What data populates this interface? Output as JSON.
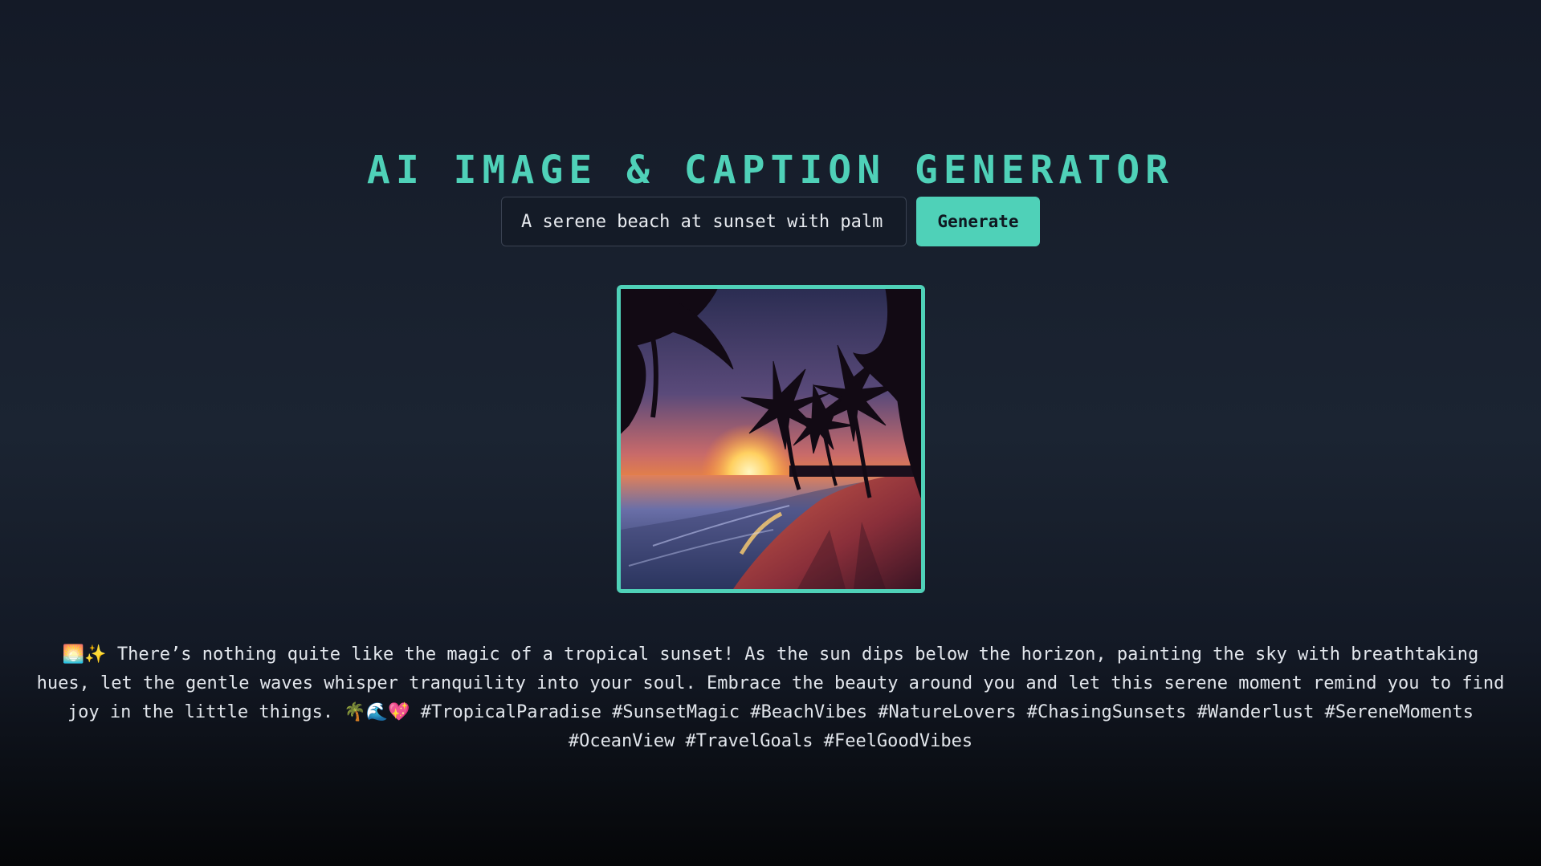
{
  "header": {
    "title": "AI IMAGE & CAPTION GENERATOR"
  },
  "prompt": {
    "value": "A serene beach at sunset with palm",
    "placeholder": "Enter a prompt"
  },
  "toolbar": {
    "generate_label": "Generate"
  },
  "image": {
    "description_icon": "tropical-sunset-image"
  },
  "caption": {
    "lead_emoji": "🌅✨",
    "text": "There’s nothing quite like the magic of a tropical sunset! As the sun dips below the horizon, painting the sky with breathtaking hues, let the gentle waves whisper tranquility into your soul. Embrace the beauty around you and let this serene moment remind you to find joy in the little things.",
    "trail_emoji": "🌴🌊💖",
    "hashtags": "#TropicalParadise #SunsetMagic #BeachVibes #NatureLovers #ChasingSunsets #Wanderlust #SereneMoments #OceanView #TravelGoals #FeelGoodVibes"
  },
  "colors": {
    "accent": "#4fd1b8",
    "background": "#1b2432",
    "text": "#e2e6ec"
  }
}
